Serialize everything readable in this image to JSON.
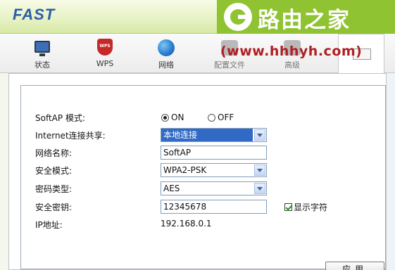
{
  "header": {
    "logo": "FAST",
    "watermark_brand": "路由之家",
    "watermark_url": "(www.hhhyh.com)"
  },
  "toolbar": {
    "items": [
      {
        "label": "状态",
        "icon": "monitor-icon"
      },
      {
        "label": "WPS",
        "icon": "wps-shield-icon"
      },
      {
        "label": "网络",
        "icon": "globe-icon"
      },
      {
        "label": "配置文件",
        "icon": "config-file-icon"
      },
      {
        "label": "高级",
        "icon": "advanced-icon"
      }
    ]
  },
  "form": {
    "softap_mode": {
      "label": "SoftAP 模式:",
      "on_label": "ON",
      "off_label": "OFF",
      "selected": "ON"
    },
    "internet_sharing": {
      "label": "Internet连接共享:",
      "value": "本地连接"
    },
    "network_name": {
      "label": "网络名称:",
      "value": "SoftAP"
    },
    "security_mode": {
      "label": "安全模式:",
      "value": "WPA2-PSK"
    },
    "cipher_type": {
      "label": "密码类型:",
      "value": "AES"
    },
    "security_key": {
      "label": "安全密钥:",
      "value": "12345678",
      "show_chars_label": "显示字符",
      "show_chars_checked": true
    },
    "ip_address": {
      "label": "IP地址:",
      "value": "192.168.0.1"
    }
  },
  "actions": {
    "apply_label": "应用"
  },
  "colors": {
    "header_green": "#d7e9a6",
    "watermark_green": "#8fc331",
    "logo_blue": "#2a5ea8",
    "select_highlight": "#316ac5"
  }
}
